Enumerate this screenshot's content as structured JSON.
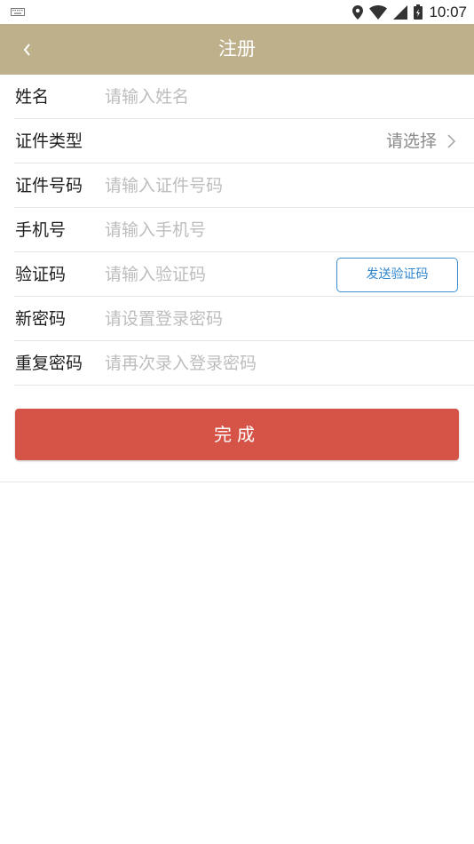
{
  "status_bar": {
    "time": "10:07"
  },
  "app_bar": {
    "title": "注册"
  },
  "form": {
    "name": {
      "label": "姓名",
      "placeholder": "请输入姓名"
    },
    "id_type": {
      "label": "证件类型",
      "value": "请选择"
    },
    "id_number": {
      "label": "证件号码",
      "placeholder": "请输入证件号码"
    },
    "phone": {
      "label": "手机号",
      "placeholder": "请输入手机号"
    },
    "code": {
      "label": "验证码",
      "placeholder": "请输入验证码",
      "send_button": "发送验证码"
    },
    "new_password": {
      "label": "新密码",
      "placeholder": "请设置登录密码"
    },
    "repeat_password": {
      "label": "重复密码",
      "placeholder": "请再次录入登录密码"
    }
  },
  "submit": {
    "label": "完成"
  },
  "colors": {
    "app_bar": "#bfb08c",
    "primary_button": "#d65447",
    "link_blue": "#2f86cf"
  }
}
